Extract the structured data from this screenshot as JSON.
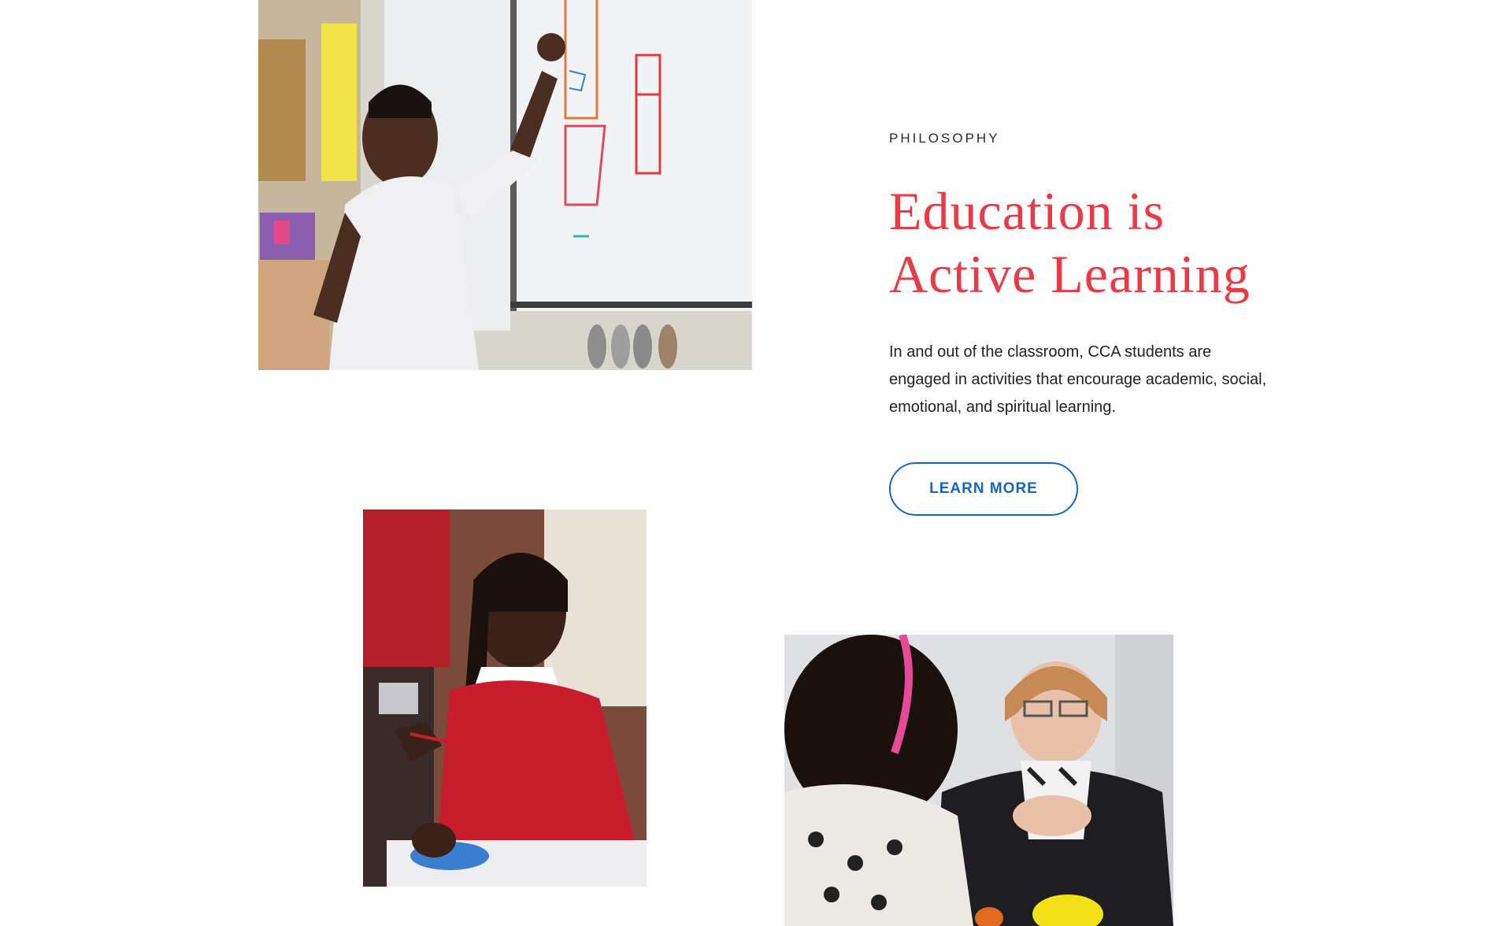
{
  "philosophy": {
    "eyebrow": "PHILOSOPHY",
    "heading_line1": "Education is",
    "heading_line2": "Active Learning",
    "body": "In and out of the classroom, CCA students are engaged in activities that encourage academic, social, emotional, and spiritual learning.",
    "cta_label": "LEARN MORE"
  },
  "colors": {
    "heading": "#ea3a45",
    "cta": "#1565c0",
    "text": "#222222"
  }
}
